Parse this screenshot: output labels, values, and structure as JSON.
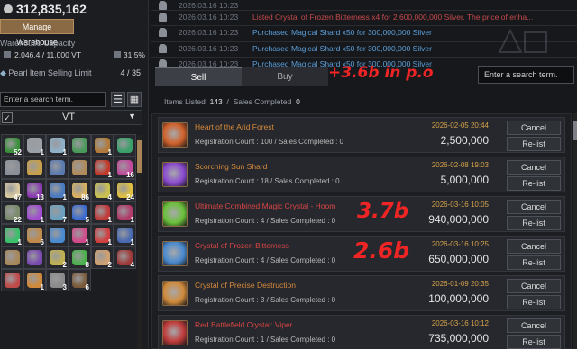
{
  "wallet": {
    "silver": "312,835,162",
    "manage_label": "Manage Warehouse"
  },
  "warehouse": {
    "label": "Warehouse Capacity",
    "capacity": "2,046.4 / 11,000 VT",
    "percent": "31.5%"
  },
  "pearl": {
    "label": "Pearl Item Selling Limit",
    "count": "4 / 35"
  },
  "left_search": {
    "placeholder": "Enter a search term."
  },
  "filter": {
    "value": "VT"
  },
  "inventory": [
    {
      "color": "#3a8f3a",
      "count": "52"
    },
    {
      "color": "#9aa0a8",
      "count": "1"
    },
    {
      "color": "#8fb0c9",
      "count": "1"
    },
    {
      "color": "#4a9a5a",
      "count": ""
    },
    {
      "color": "#b07a3a",
      "count": "1"
    },
    {
      "color": "#3aa06a",
      "count": ""
    },
    {
      "color": "#8a8f98",
      "count": ""
    },
    {
      "color": "#c9a04a",
      "count": ""
    },
    {
      "color": "#5a7ab0",
      "count": ""
    },
    {
      "color": "#b08a5a",
      "count": ""
    },
    {
      "color": "#c0392b",
      "count": "1"
    },
    {
      "color": "#c04a9a",
      "count": "16"
    },
    {
      "color": "#d8c8a0",
      "count": "47"
    },
    {
      "color": "#8a3ab0",
      "count": "13"
    },
    {
      "color": "#4a7ac0",
      "count": "1"
    },
    {
      "color": "#d8b060",
      "count": "86"
    },
    {
      "color": "#c9c050",
      "count": "4"
    },
    {
      "color": "#e0c040",
      "count": "24"
    },
    {
      "color": "#7a8a6a",
      "count": "22"
    },
    {
      "color": "#a04ad0",
      "count": "1"
    },
    {
      "color": "#6aa0c0",
      "count": "7"
    },
    {
      "color": "#3a6ad0",
      "count": "5"
    },
    {
      "color": "#c03a3a",
      "count": "1"
    },
    {
      "color": "#b03a6a",
      "count": "1"
    },
    {
      "color": "#3ac06a",
      "count": "1"
    },
    {
      "color": "#c08a4a",
      "count": "6"
    },
    {
      "color": "#4a8ad0",
      "count": ""
    },
    {
      "color": "#d04a8a",
      "count": "1"
    },
    {
      "color": "#d04040",
      "count": "1"
    },
    {
      "color": "#4a6ab0",
      "count": "1"
    },
    {
      "color": "#a8875a",
      "count": ""
    },
    {
      "color": "#7a4ab0",
      "count": ""
    },
    {
      "color": "#c0b050",
      "count": "2"
    },
    {
      "color": "#4ab04a",
      "count": "8"
    },
    {
      "color": "#d0a070",
      "count": "2"
    },
    {
      "color": "#a03a3a",
      "count": "4"
    },
    {
      "color": "#c04a4a",
      "count": ""
    },
    {
      "color": "#d08a3a",
      "count": "1"
    },
    {
      "color": "#8a8a8a",
      "count": "3"
    },
    {
      "color": "#7a5a3a",
      "count": "6"
    }
  ],
  "log": [
    {
      "time": "2026.03.16 10:23",
      "msg": "",
      "red": false
    },
    {
      "time": "2026.03.16 10:23",
      "msg": "Listed Crystal of Frozen Bitterness x4 for 2,600,000,000 Silver. The price of enha...",
      "red": true
    },
    {
      "time": "2026.03.16 10:23",
      "msg": "Purchased Magical Shard x50 for 300,000,000 Silver",
      "red": false
    },
    {
      "time": "2026.03.16 10:23",
      "msg": "Purchased Magical Shard x50 for 300,000,000 Silver",
      "red": false
    },
    {
      "time": "2026.03.16 10:23",
      "msg": "Purchased Magical Shard x50 for 300,000,000 Silver",
      "red": false
    }
  ],
  "tabs": {
    "sell": "Sell",
    "buy": "Buy"
  },
  "right_search": {
    "placeholder": "Enter a search term."
  },
  "listing_info": {
    "listed_label": "Items Listed",
    "listed": "143",
    "sep": "/",
    "completed_label": "Sales Completed",
    "completed": "0"
  },
  "annotations": {
    "top": "+3.6b in p.o",
    "a1": "3.7b",
    "a2": "2.6b"
  },
  "buttons": {
    "cancel": "Cancel",
    "relist": "Re-list"
  },
  "listings": [
    {
      "name": "Heart of the Arid Forest",
      "sub": "Registration Count : 100 / Sales Completed : 0",
      "date": "2026-02-05 20:44",
      "price": "2,500,000",
      "red": false,
      "icon": "#d0602a"
    },
    {
      "name": "Scorching Sun Shard",
      "sub": "Registration Count : 18 / Sales Completed : 0",
      "date": "2026-02-08 19:03",
      "price": "5,000,000",
      "red": false,
      "icon": "#8a4ad0"
    },
    {
      "name": "Ultimate Combined Magic Crystal - Hoom",
      "sub": "Registration Count : 4 / Sales Completed : 0",
      "date": "2026-03-16 10:05",
      "price": "940,000,000",
      "red": true,
      "icon": "#6ac03a"
    },
    {
      "name": "Crystal of Frozen Bitterness",
      "sub": "Registration Count : 4 / Sales Completed : 0",
      "date": "2026-03-16 10:25",
      "price": "650,000,000",
      "red": true,
      "icon": "#4a8ad0"
    },
    {
      "name": "Crystal of Precise Destruction",
      "sub": "Registration Count : 3 / Sales Completed : 0",
      "date": "2026-01-09 20:35",
      "price": "100,000,000",
      "red": false,
      "icon": "#d08a3a"
    },
    {
      "name": "Red Battlefield Crystal: Viper",
      "sub": "Registration Count : 1 / Sales Completed : 0",
      "date": "2026-03-16 10:12",
      "price": "735,000,000",
      "red": true,
      "icon": "#c03a3a"
    }
  ]
}
